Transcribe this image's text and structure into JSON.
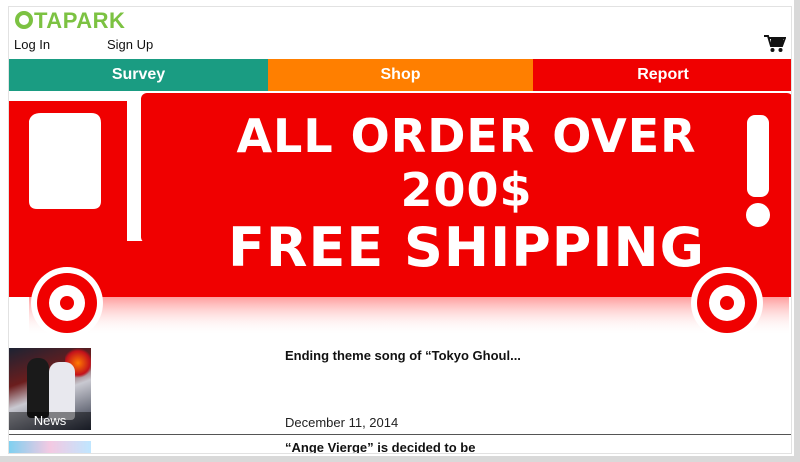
{
  "header": {
    "logo_text": "TAPARK",
    "login_label": "Log In",
    "signup_label": "Sign Up"
  },
  "nav": {
    "survey_label": "Survey",
    "shop_label": "Shop",
    "report_label": "Report"
  },
  "banner": {
    "line1": "ALL ORDER OVER 200$",
    "line2": "FREE SHIPPING",
    "mark": "!"
  },
  "news": [
    {
      "title": "Ending theme song of “Tokyo Ghoul...",
      "date": "December 11, 2014",
      "category": "News"
    },
    {
      "title": "“Ange Vierge” is decided to be"
    }
  ],
  "colors": {
    "logo_green": "#7cc242",
    "survey": "#1a9c82",
    "shop": "#ff7f00",
    "report": "#f00000",
    "banner_red": "#f00000"
  },
  "icons": [
    "cart-icon"
  ]
}
